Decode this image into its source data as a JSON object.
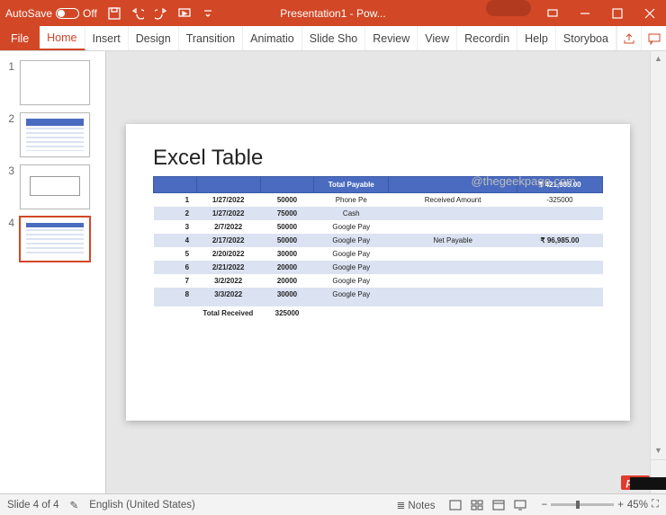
{
  "titlebar": {
    "autosave_label": "AutoSave",
    "autosave_state": "Off",
    "doc_title": "Presentation1 - Pow..."
  },
  "ribbon": {
    "file": "File",
    "tabs": [
      "Home",
      "Insert",
      "Design",
      "Transition",
      "Animatio",
      "Slide Sho",
      "Review",
      "View",
      "Recordin",
      "Help",
      "Storyboa"
    ],
    "active_index": 0
  },
  "thumbnails": {
    "items": [
      {
        "num": "1",
        "kind": "blank"
      },
      {
        "num": "2",
        "kind": "bar"
      },
      {
        "num": "3",
        "kind": "box"
      },
      {
        "num": "4",
        "kind": "table",
        "selected": true
      }
    ]
  },
  "slide": {
    "title": "Excel Table",
    "watermark": "@thegeekpage.com",
    "headers": {
      "total_payable": "Total Payable",
      "total_payable_val": "₹ 421,985.00"
    },
    "rows": [
      {
        "n": "1",
        "date": "1/27/2022",
        "amt": "50000",
        "mode": "Phone Pe",
        "label": "Received Amount",
        "val": "-325000"
      },
      {
        "n": "2",
        "date": "1/27/2022",
        "amt": "75000",
        "mode": "Cash",
        "label": "",
        "val": ""
      },
      {
        "n": "3",
        "date": "2/7/2022",
        "amt": "50000",
        "mode": "Google Pay",
        "label": "",
        "val": ""
      },
      {
        "n": "4",
        "date": "2/17/2022",
        "amt": "50000",
        "mode": "Google Pay",
        "label": "Net Payable",
        "val": "₹ 96,985.00"
      },
      {
        "n": "5",
        "date": "2/20/2022",
        "amt": "30000",
        "mode": "Google Pay",
        "label": "",
        "val": ""
      },
      {
        "n": "6",
        "date": "2/21/2022",
        "amt": "20000",
        "mode": "Google Pay",
        "label": "",
        "val": ""
      },
      {
        "n": "7",
        "date": "3/2/2022",
        "amt": "20000",
        "mode": "Google Pay",
        "label": "",
        "val": ""
      },
      {
        "n": "8",
        "date": "3/3/2022",
        "amt": "30000",
        "mode": "Google Pay",
        "label": "",
        "val": ""
      }
    ],
    "footer": {
      "label": "Total Received",
      "val": "325000"
    }
  },
  "status": {
    "slide_info": "Slide 4 of 4",
    "lang": "English (United States)",
    "notes": "Notes",
    "zoom": "45%"
  },
  "badge": "php"
}
